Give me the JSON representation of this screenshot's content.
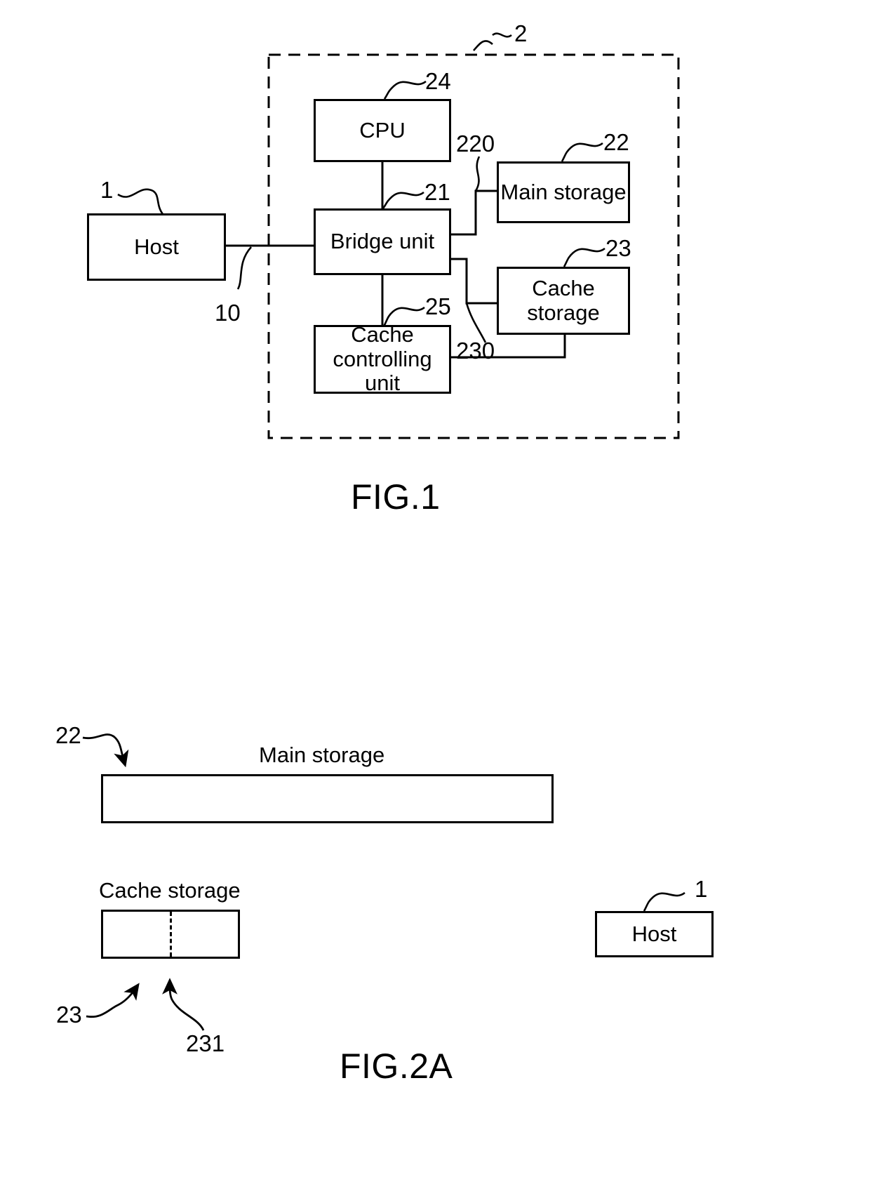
{
  "document": {
    "type": "patent-figure-sheet",
    "figures": [
      {
        "caption": "FIG.1",
        "blocks": [
          {
            "id": "host",
            "label": "Host",
            "ref": "1"
          },
          {
            "id": "cpu",
            "label": "CPU",
            "ref": "24"
          },
          {
            "id": "bridge",
            "label": "Bridge unit",
            "ref": "21"
          },
          {
            "id": "main-storage",
            "label": "Main storage",
            "ref": "22"
          },
          {
            "id": "cache-storage",
            "label": "Cache\nstorage",
            "ref": "23"
          },
          {
            "id": "cache-controlling",
            "label": "Cache\ncontrolling\nunit",
            "ref": "25"
          }
        ],
        "connection_refs": [
          {
            "id": "host-link",
            "ref": "10"
          },
          {
            "id": "main-storage-bus",
            "ref": "220"
          },
          {
            "id": "cache-storage-bus",
            "ref": "230"
          }
        ],
        "enclosure_ref": "2"
      },
      {
        "caption": "FIG.2A",
        "blocks": [
          {
            "id": "main-storage-bar",
            "label": "Main storage",
            "ref": "22"
          },
          {
            "id": "cache-storage-bar",
            "label": "Cache storage",
            "ref": "23"
          },
          {
            "id": "host-box",
            "label": "Host",
            "ref": "1"
          }
        ],
        "divider_ref": "231"
      }
    ]
  },
  "fig1": {
    "caption": "FIG.1",
    "enclosure": {
      "ref": "2"
    },
    "host": {
      "label": "Host",
      "ref": "1"
    },
    "cpu": {
      "label": "CPU",
      "ref": "24"
    },
    "bridge": {
      "label": "Bridge unit",
      "ref": "21"
    },
    "main_storage": {
      "label": "Main storage",
      "ref": "22"
    },
    "cache_storage": {
      "label_line1": "Cache",
      "label_line2": "storage",
      "ref": "23"
    },
    "cache_controlling": {
      "label_line1": "Cache",
      "label_line2": "controlling",
      "label_line3": "unit",
      "ref": "25"
    },
    "link_host": {
      "ref": "10"
    },
    "bus_main": {
      "ref": "220"
    },
    "bus_cache": {
      "ref": "230"
    }
  },
  "fig2a": {
    "caption": "FIG.2A",
    "main_storage": {
      "label": "Main storage",
      "ref": "22"
    },
    "cache_storage": {
      "label": "Cache storage",
      "ref": "23",
      "divider_ref": "231"
    },
    "host": {
      "label": "Host",
      "ref": "1"
    }
  },
  "colors": {
    "line": "#000000",
    "background": "#ffffff"
  }
}
